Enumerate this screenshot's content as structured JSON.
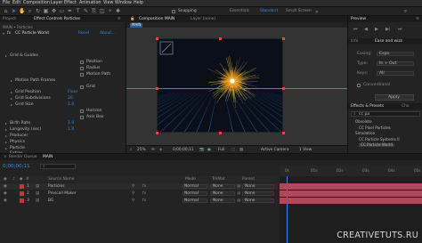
{
  "menubar": {
    "items": [
      "File",
      "Edit",
      "Composition",
      "Layer",
      "Effect",
      "Animation",
      "View",
      "Window",
      "Help"
    ]
  },
  "toolbar": {
    "snapping": "Snapping",
    "workspaces": [
      "Standard",
      "Small Screen"
    ],
    "standard_extra": "Essentials"
  },
  "project_panel": {
    "tab_project": "Project",
    "tab_effect_controls": "Effect Controls Particles",
    "breadcrumb": "MAIN • Particles"
  },
  "effect_controls": {
    "effect_name": "CC Particle World",
    "reset_label": "Reset",
    "about_label": "About...",
    "rows": [
      {
        "label": "Grid & Guides",
        "indent": 1
      },
      {
        "label": "Position",
        "indent": 5,
        "check": true
      },
      {
        "label": "Radius",
        "indent": 5,
        "check": true
      },
      {
        "label": "Motion Path",
        "indent": 5,
        "check": true
      },
      {
        "label": "Motion Path Frames",
        "indent": 3
      },
      {
        "label": "Grid",
        "indent": 5,
        "check": true
      },
      {
        "label": "Grid Position",
        "indent": 3,
        "value": "Floor"
      },
      {
        "label": "Grid Subdivisions",
        "indent": 3,
        "value": "20"
      },
      {
        "label": "Grid Size",
        "indent": 3,
        "value": "1.0"
      },
      {
        "label": "Horizon",
        "indent": 5,
        "check": true
      },
      {
        "label": "Axis Box",
        "indent": 5,
        "check": true
      },
      {
        "label": "Birth Rate",
        "indent": 1,
        "value": "1.0"
      },
      {
        "label": "Longevity (sec)",
        "indent": 1,
        "value": "1.0"
      },
      {
        "label": "Producer",
        "indent": 1
      },
      {
        "label": "Physics",
        "indent": 1
      },
      {
        "label": "Particle",
        "indent": 1
      },
      {
        "label": "Extras",
        "indent": 1
      }
    ]
  },
  "composition": {
    "tab_label": "Composition MAIN",
    "layer_tab": "Layer (none)",
    "breadcrumb": "MAIN",
    "zoom": "25%",
    "timecode": "0;00;00;11",
    "resolution": "Full",
    "camera": "Active Camera",
    "views": "1 View"
  },
  "right_panel": {
    "tab_preview": "Preview",
    "tab_info": "Info",
    "section_title": "Ease and wizz",
    "easing_label": "Easing:",
    "easing_value": "Expo",
    "type_label": "Type:",
    "type_value": "In + Out",
    "keys_label": "Keys:",
    "keys_value": "All",
    "conventional_label": "Conventional",
    "apply_label": "Apply",
    "tab_effects": "Effects & Presets",
    "tab_char": "Cha",
    "search_value": "cc pa",
    "tree": [
      {
        "label": "Obsolete",
        "indent": 1
      },
      {
        "label": "CC Pixel Particles",
        "indent": 2
      },
      {
        "label": "Simulation",
        "indent": 1
      },
      {
        "label": "CC Particle Systems II",
        "indent": 2
      },
      {
        "label": "CC Particle World",
        "indent": 2
      }
    ]
  },
  "timeline": {
    "tab_render": "Render Queue",
    "tab_main": "MAIN",
    "timecode": "0;00;00;11",
    "col_name": "Source Name",
    "col_mode": "Mode",
    "col_trkmat": "TrkMat",
    "col_parent": "Parent",
    "layers": [
      {
        "num": "1",
        "name": "Particles",
        "mode": "Normal",
        "trkmat": "None",
        "parent": "None"
      },
      {
        "num": "2",
        "name": "Prescall Maker",
        "mode": "Normal",
        "trkmat": "None",
        "parent": "None"
      },
      {
        "num": "3",
        "name": "BG",
        "mode": "Normal",
        "trkmat": "None",
        "parent": "None"
      }
    ],
    "ruler": [
      "0s",
      "01s",
      "02s",
      "03s",
      "04s",
      "05s"
    ]
  },
  "watermark": "CREATIVETUTS.RU",
  "colors": {
    "accent": "#2d8ceb",
    "layer_red": "#c8343d",
    "bar_pink": "#b0485b"
  }
}
